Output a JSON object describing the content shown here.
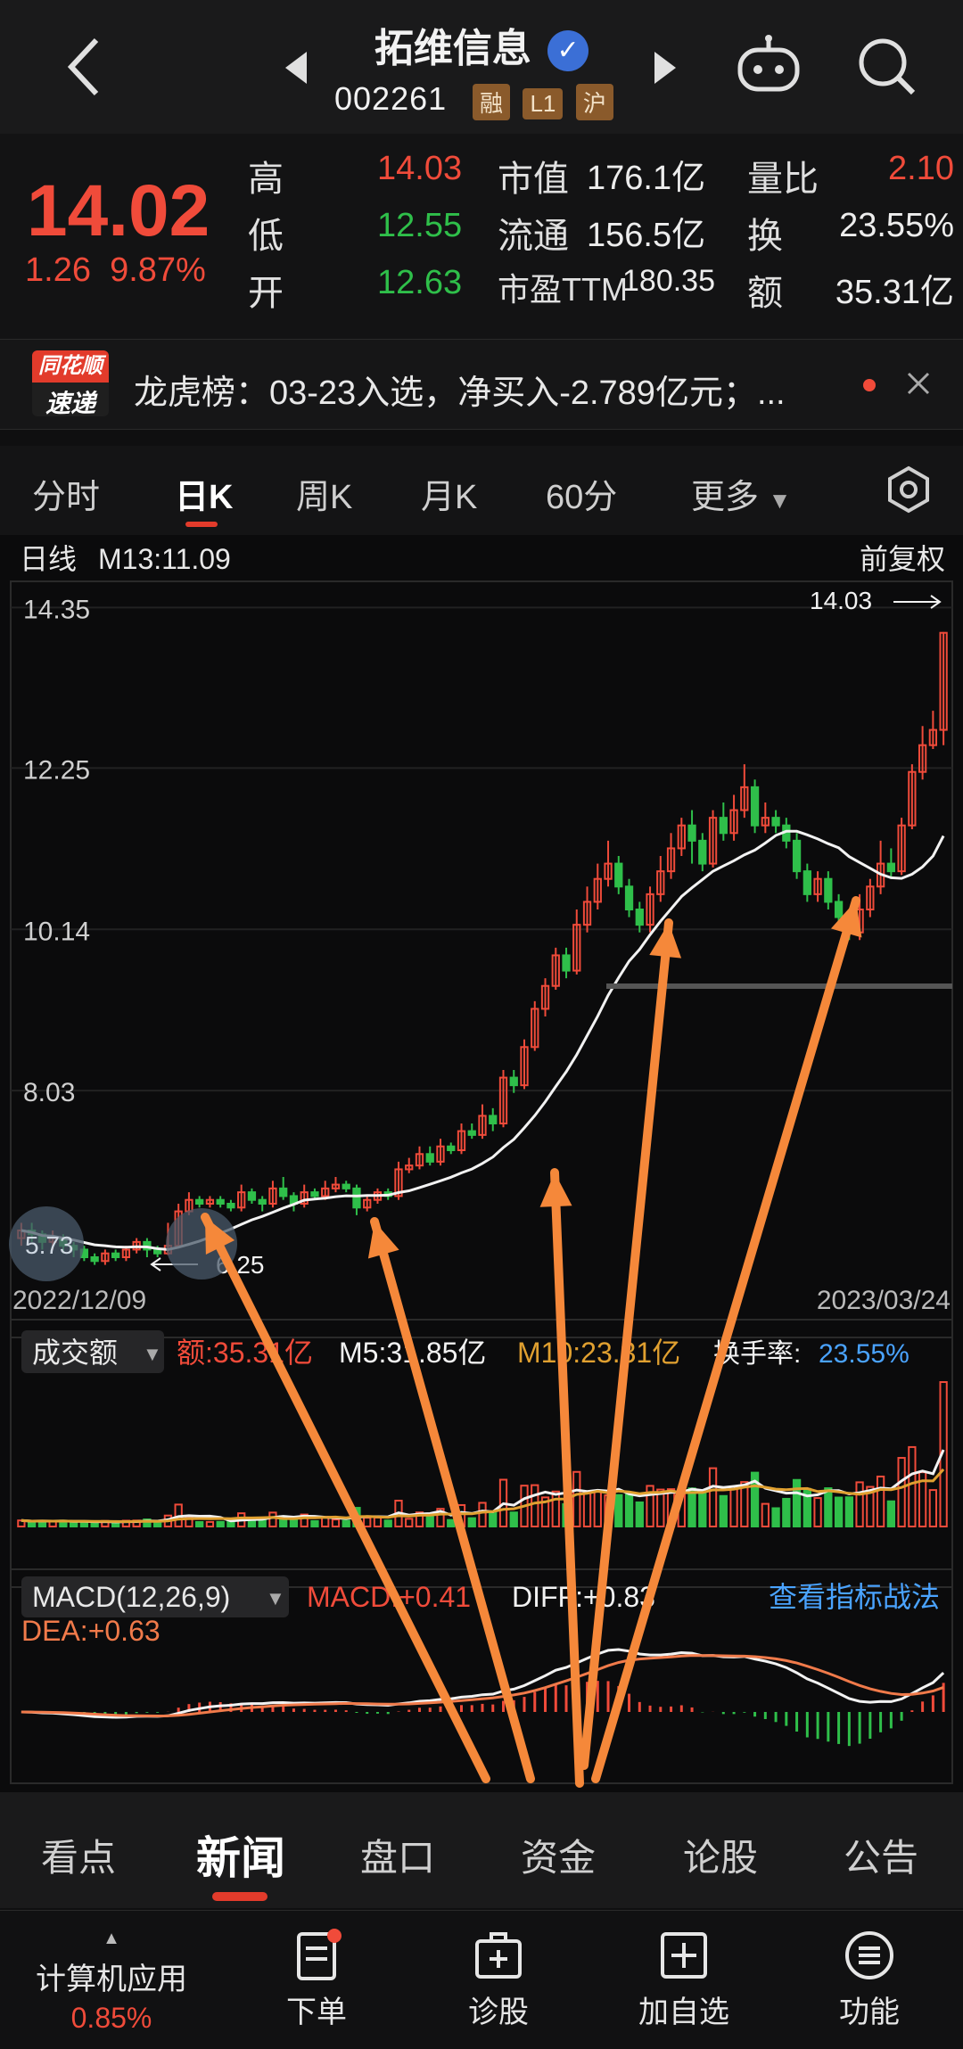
{
  "header": {
    "title": "拓维信息",
    "code": "002261",
    "tags": [
      "融",
      "L1",
      "沪"
    ]
  },
  "quote": {
    "price": "14.02",
    "change": "1.26",
    "change_pct": "9.87%",
    "rows": [
      {
        "l1": "高",
        "v1": "14.03",
        "l2": "市值",
        "v2": "176.1亿",
        "l3": "量比",
        "v3": "2.10"
      },
      {
        "l1": "低",
        "v1": "12.55",
        "l2": "流通",
        "v2": "156.5亿",
        "l3": "换",
        "v3": "23.55%"
      },
      {
        "l1": "开",
        "v1": "12.63",
        "l2": "市盈TTM",
        "v2": "180.35",
        "l3": "额",
        "v3": "35.31亿"
      }
    ]
  },
  "ticker": {
    "logo_top": "同花顺",
    "logo_bottom": "速递",
    "text": "龙虎榜：03-23入选，净买入-2.789亿元；..."
  },
  "ktabs": [
    "分时",
    "日K",
    "周K",
    "月K",
    "60分",
    "更多"
  ],
  "chart_info": {
    "label": "日线",
    "ma": "M13:11.09",
    "adjust": "前复权",
    "max_label": "14.03",
    "min_label": "6.25",
    "left_bubble": "5.73",
    "date_start": "2022/12/09",
    "date_end": "2023/03/24"
  },
  "volume_panel": {
    "selector": "成交额",
    "amount": "额:35.31亿",
    "m5": "M5:31.85亿",
    "m10": "M10:23.31亿",
    "turnover_label": "换手率:",
    "turnover_value": "23.55%"
  },
  "macd_panel": {
    "selector": "MACD(12,26,9)",
    "macd": "MACD:+0.41",
    "diff": "DIFF:+0.83",
    "dea": "DEA:+0.63",
    "link": "查看指标战法"
  },
  "bottom_tabs": [
    "看点",
    "新闻",
    "盘口",
    "资金",
    "论股",
    "公告"
  ],
  "bottom_nav": {
    "sector": "计算机应用",
    "sector_pct": "0.85%",
    "items": [
      "下单",
      "诊股",
      "加自选",
      "功能"
    ]
  },
  "chart_data": {
    "type": "candlestick",
    "y_ticks": [
      14.35,
      12.25,
      10.14,
      8.03
    ],
    "ylim": [
      5.5,
      14.6
    ],
    "x_start": "2022/12/09",
    "x_end": "2023/03/24",
    "candles": [
      [
        6.1,
        6.2,
        6.3,
        6.0
      ],
      [
        6.2,
        6.15,
        6.3,
        6.05
      ],
      [
        6.15,
        6.05,
        6.2,
        5.95
      ],
      [
        6.05,
        6.1,
        6.2,
        5.95
      ],
      [
        6.1,
        6.0,
        6.15,
        5.9
      ],
      [
        6.0,
        5.95,
        6.05,
        5.85
      ],
      [
        5.95,
        5.85,
        6.0,
        5.8
      ],
      [
        5.85,
        5.8,
        5.9,
        5.75
      ],
      [
        5.8,
        5.9,
        5.95,
        5.75
      ],
      [
        5.9,
        5.85,
        5.95,
        5.8
      ],
      [
        5.85,
        5.95,
        6.0,
        5.8
      ],
      [
        5.95,
        6.05,
        6.1,
        5.9
      ],
      [
        6.05,
        5.95,
        6.1,
        5.85
      ],
      [
        5.95,
        5.9,
        6.0,
        5.85
      ],
      [
        5.9,
        6.0,
        6.3,
        5.88
      ],
      [
        6.0,
        6.45,
        6.55,
        5.98
      ],
      [
        6.45,
        6.6,
        6.7,
        6.4
      ],
      [
        6.6,
        6.55,
        6.65,
        6.5
      ],
      [
        6.55,
        6.6,
        6.65,
        6.5
      ],
      [
        6.6,
        6.55,
        6.65,
        6.5
      ],
      [
        6.55,
        6.5,
        6.6,
        6.45
      ],
      [
        6.5,
        6.7,
        6.8,
        6.45
      ],
      [
        6.7,
        6.6,
        6.75,
        6.55
      ],
      [
        6.6,
        6.55,
        6.65,
        6.45
      ],
      [
        6.55,
        6.75,
        6.85,
        6.5
      ],
      [
        6.75,
        6.65,
        6.9,
        6.6
      ],
      [
        6.65,
        6.55,
        6.7,
        6.45
      ],
      [
        6.55,
        6.7,
        6.8,
        6.5
      ],
      [
        6.7,
        6.65,
        6.75,
        6.6
      ],
      [
        6.65,
        6.75,
        6.85,
        6.6
      ],
      [
        6.75,
        6.8,
        6.9,
        6.7
      ],
      [
        6.8,
        6.75,
        6.85,
        6.7
      ],
      [
        6.75,
        6.5,
        6.8,
        6.4
      ],
      [
        6.5,
        6.6,
        6.65,
        6.45
      ],
      [
        6.6,
        6.7,
        6.75,
        6.55
      ],
      [
        6.7,
        6.65,
        6.75,
        6.6
      ],
      [
        6.65,
        7.0,
        7.1,
        6.6
      ],
      [
        7.0,
        7.05,
        7.15,
        6.95
      ],
      [
        7.05,
        7.2,
        7.3,
        7.0
      ],
      [
        7.2,
        7.1,
        7.3,
        7.05
      ],
      [
        7.1,
        7.3,
        7.4,
        7.05
      ],
      [
        7.3,
        7.25,
        7.35,
        7.2
      ],
      [
        7.25,
        7.5,
        7.6,
        7.2
      ],
      [
        7.5,
        7.45,
        7.6,
        7.4
      ],
      [
        7.45,
        7.7,
        7.85,
        7.4
      ],
      [
        7.7,
        7.6,
        7.8,
        7.5
      ],
      [
        7.6,
        8.2,
        8.3,
        7.55
      ],
      [
        8.2,
        8.1,
        8.3,
        8.0
      ],
      [
        8.1,
        8.6,
        8.7,
        8.05
      ],
      [
        8.6,
        9.1,
        9.2,
        8.55
      ],
      [
        9.1,
        9.4,
        9.5,
        9.0
      ],
      [
        9.4,
        9.8,
        9.9,
        9.35
      ],
      [
        9.8,
        9.6,
        9.9,
        9.5
      ],
      [
        9.6,
        10.2,
        10.4,
        9.55
      ],
      [
        10.2,
        10.5,
        10.7,
        10.1
      ],
      [
        10.5,
        10.8,
        11.0,
        10.4
      ],
      [
        10.8,
        11.0,
        11.3,
        10.7
      ],
      [
        11.0,
        10.7,
        11.1,
        10.6
      ],
      [
        10.7,
        10.4,
        10.8,
        10.3
      ],
      [
        10.4,
        10.2,
        10.5,
        10.1
      ],
      [
        10.2,
        10.6,
        10.7,
        10.1
      ],
      [
        10.6,
        10.9,
        11.1,
        10.5
      ],
      [
        10.9,
        11.2,
        11.4,
        10.8
      ],
      [
        11.2,
        11.5,
        11.6,
        11.1
      ],
      [
        11.5,
        11.3,
        11.7,
        11.0
      ],
      [
        11.3,
        11.0,
        11.4,
        10.9
      ],
      [
        11.0,
        11.6,
        11.7,
        10.95
      ],
      [
        11.6,
        11.4,
        11.8,
        11.3
      ],
      [
        11.4,
        11.7,
        11.9,
        11.3
      ],
      [
        11.7,
        12.0,
        12.3,
        11.6
      ],
      [
        12.0,
        11.5,
        12.1,
        11.4
      ],
      [
        11.5,
        11.6,
        11.8,
        11.4
      ],
      [
        11.6,
        11.5,
        11.7,
        11.4
      ],
      [
        11.5,
        11.3,
        11.6,
        11.2
      ],
      [
        11.3,
        10.9,
        11.4,
        10.8
      ],
      [
        10.9,
        10.6,
        11.0,
        10.5
      ],
      [
        10.6,
        10.8,
        10.9,
        10.5
      ],
      [
        10.8,
        10.5,
        10.9,
        10.4
      ],
      [
        10.5,
        10.3,
        10.6,
        10.2
      ],
      [
        10.3,
        10.1,
        10.4,
        10.0
      ],
      [
        10.1,
        10.4,
        10.6,
        10.0
      ],
      [
        10.4,
        10.7,
        10.8,
        10.3
      ],
      [
        10.7,
        11.0,
        11.3,
        10.6
      ],
      [
        11.0,
        10.9,
        11.2,
        10.8
      ],
      [
        10.9,
        11.5,
        11.6,
        10.85
      ],
      [
        11.5,
        12.2,
        12.3,
        11.45
      ],
      [
        12.2,
        12.55,
        12.8,
        12.1
      ],
      [
        12.55,
        12.75,
        13.0,
        12.5
      ],
      [
        12.75,
        14.02,
        14.03,
        12.55
      ]
    ]
  }
}
